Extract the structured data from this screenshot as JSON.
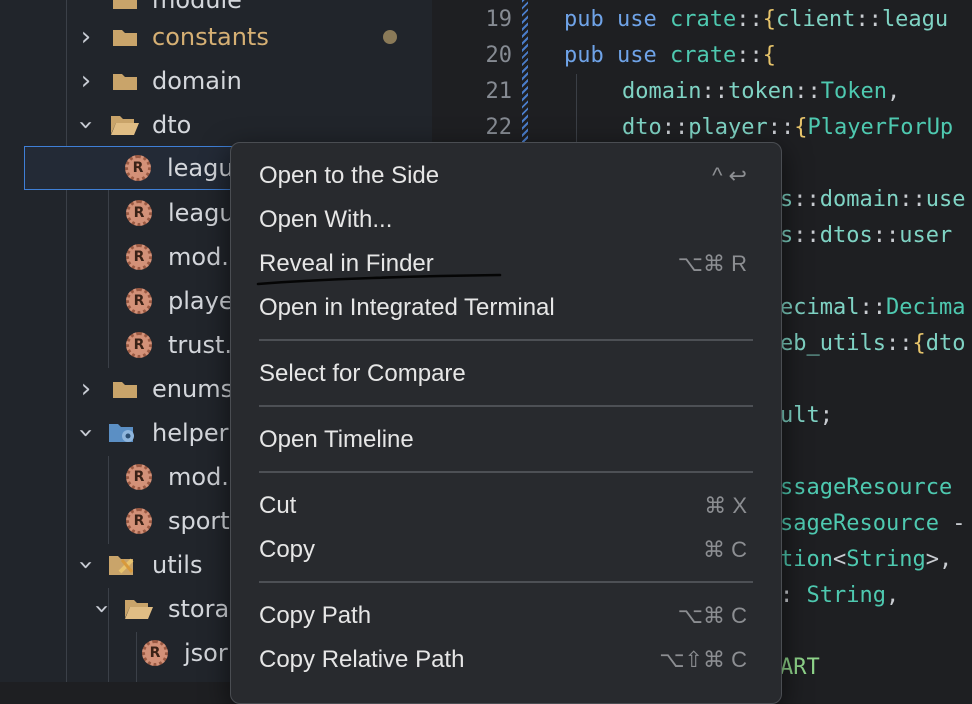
{
  "explorer": {
    "rows": [
      {
        "label": "module",
        "type": "folder"
      },
      {
        "label": "constants",
        "type": "folder",
        "modified": true
      },
      {
        "label": "domain",
        "type": "folder"
      },
      {
        "label": "dto",
        "type": "folder-open"
      },
      {
        "label": "leagu",
        "type": "rust"
      },
      {
        "label": "leagu",
        "type": "rust"
      },
      {
        "label": "mod.",
        "type": "rust"
      },
      {
        "label": "playe",
        "type": "rust"
      },
      {
        "label": "trust.",
        "type": "rust"
      },
      {
        "label": "enums",
        "type": "folder"
      },
      {
        "label": "helper",
        "type": "folder-special"
      },
      {
        "label": "mod.",
        "type": "rust"
      },
      {
        "label": "sport",
        "type": "rust"
      },
      {
        "label": "utils",
        "type": "folder-tools"
      },
      {
        "label": "stora",
        "type": "folder-open"
      },
      {
        "label": "jsor",
        "type": "rust"
      }
    ]
  },
  "editor": {
    "line_numbers": [
      "19",
      "20",
      "21",
      "22"
    ],
    "lines": [
      {
        "kw1": "pub",
        "kw2": "use",
        "rest": [
          {
            "t": "crate",
            "c": "ty"
          },
          {
            "t": "::",
            "c": "pn"
          },
          {
            "t": "{",
            "c": "br"
          },
          {
            "t": "client",
            "c": "id"
          },
          {
            "t": "::",
            "c": "pn"
          },
          {
            "t": "leagu",
            "c": "id"
          }
        ]
      },
      {
        "kw1": "pub",
        "kw2": "use",
        "rest": [
          {
            "t": "crate",
            "c": "ty"
          },
          {
            "t": "::",
            "c": "pn"
          },
          {
            "t": "{",
            "c": "br"
          }
        ]
      },
      {
        "indent": true,
        "rest": [
          {
            "t": "domain",
            "c": "id"
          },
          {
            "t": "::",
            "c": "pn"
          },
          {
            "t": "token",
            "c": "id"
          },
          {
            "t": "::",
            "c": "pn"
          },
          {
            "t": "Token",
            "c": "ty"
          },
          {
            "t": ",",
            "c": "pn"
          }
        ]
      },
      {
        "indent": true,
        "rest": [
          {
            "t": "dto",
            "c": "id"
          },
          {
            "t": "::",
            "c": "pn"
          },
          {
            "t": "player",
            "c": "id"
          },
          {
            "t": "::",
            "c": "pn"
          },
          {
            "t": "{",
            "c": "br"
          },
          {
            "t": "PlayerForUp",
            "c": "ty"
          }
        ]
      }
    ],
    "visible_fragments": [
      [
        {
          "t": "s",
          "c": "id"
        },
        {
          "t": "::",
          "c": "pn"
        },
        {
          "t": "domain",
          "c": "id"
        },
        {
          "t": "::",
          "c": "pn"
        },
        {
          "t": "use",
          "c": "id"
        }
      ],
      [
        {
          "t": "s",
          "c": "id"
        },
        {
          "t": "::",
          "c": "pn"
        },
        {
          "t": "dtos",
          "c": "id"
        },
        {
          "t": "::",
          "c": "pn"
        },
        {
          "t": "user",
          "c": "id"
        }
      ],
      [
        {
          "t": "ecimal",
          "c": "id"
        },
        {
          "t": "::",
          "c": "pn"
        },
        {
          "t": "Decima",
          "c": "ty"
        }
      ],
      [
        {
          "t": "eb_utils",
          "c": "id"
        },
        {
          "t": "::",
          "c": "pn"
        },
        {
          "t": "{",
          "c": "br"
        },
        {
          "t": "dto",
          "c": "id"
        }
      ],
      [
        {
          "t": "ult",
          "c": "id"
        },
        {
          "t": ";",
          "c": "pn"
        }
      ],
      [
        {
          "t": "ssageResource",
          "c": "ty"
        }
      ],
      [
        {
          "t": "sageResource",
          "c": "ty"
        },
        {
          "t": " -",
          "c": "pn"
        }
      ],
      [
        {
          "t": "tion",
          "c": "ty"
        },
        {
          "t": "<",
          "c": "pn"
        },
        {
          "t": "String",
          "c": "ty"
        },
        {
          "t": ">,",
          "c": "pn"
        }
      ],
      [
        {
          "t": ": ",
          "c": "pn"
        },
        {
          "t": "String",
          "c": "ty"
        },
        {
          "t": ",",
          "c": "pn"
        }
      ],
      [
        {
          "t": "ART",
          "c": "st"
        }
      ]
    ]
  },
  "context_menu": {
    "items": [
      {
        "label": "Open to the Side",
        "shortcut": "^ ↩"
      },
      {
        "label": "Open With...",
        "shortcut": ""
      },
      {
        "label": "Reveal in Finder",
        "shortcut": "⌥⌘ R"
      },
      {
        "label": "Open in Integrated Terminal",
        "shortcut": ""
      },
      {
        "label": "Select for Compare",
        "shortcut": ""
      },
      {
        "label": "Open Timeline",
        "shortcut": ""
      },
      {
        "label": "Cut",
        "shortcut": "⌘ X"
      },
      {
        "label": "Copy",
        "shortcut": "⌘ C"
      },
      {
        "label": "Copy Path",
        "shortcut": "⌥⌘ C"
      },
      {
        "label": "Copy Relative Path",
        "shortcut": "⌥⇧⌘ C"
      }
    ]
  },
  "colors": {
    "accent": "#3f7fd6",
    "folder": "#c9a46a",
    "rust_icon": "#d39178"
  }
}
